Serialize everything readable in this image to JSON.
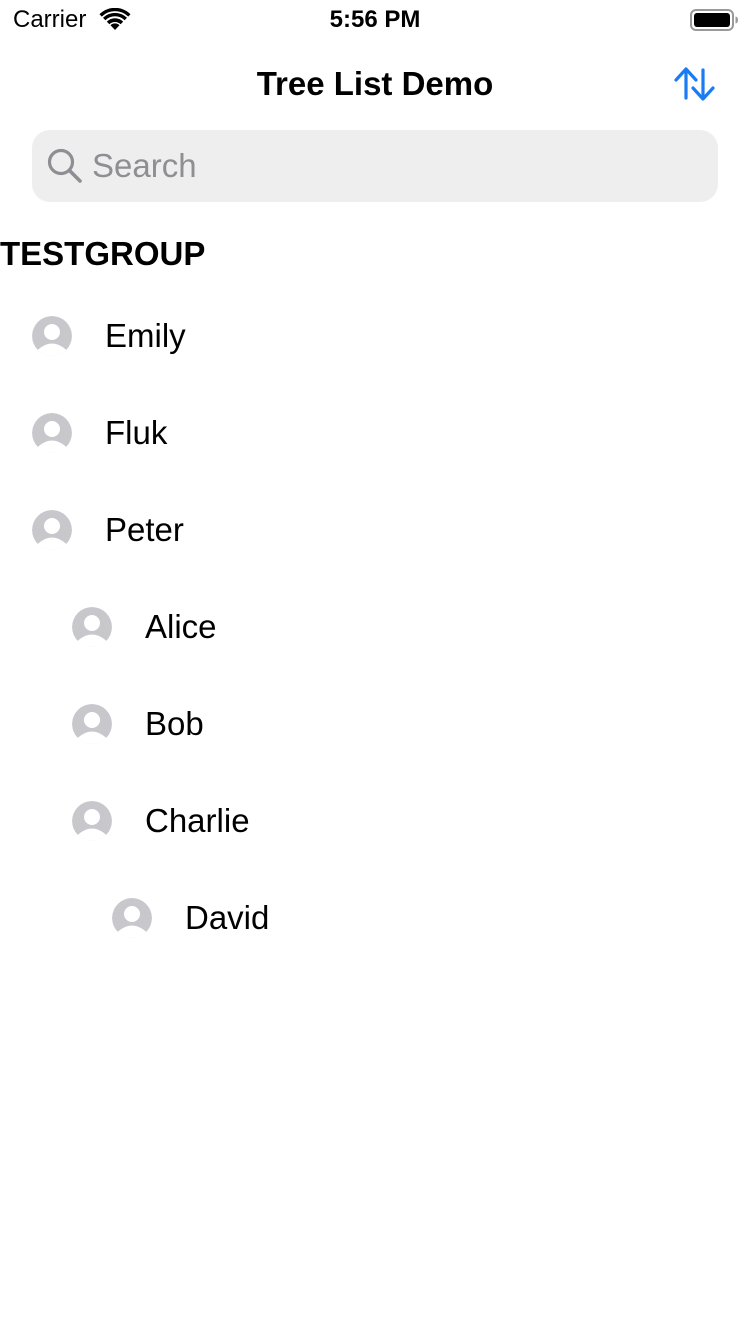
{
  "status_bar": {
    "carrier": "Carrier",
    "time": "5:56 PM"
  },
  "nav": {
    "title": "Tree List Demo",
    "sort_icon": "sort-arrows-icon"
  },
  "search": {
    "placeholder": "Search",
    "value": ""
  },
  "section": {
    "title": "TESTGROUP"
  },
  "tree": {
    "items": [
      {
        "label": "Emily",
        "depth": 0
      },
      {
        "label": "Fluk",
        "depth": 0
      },
      {
        "label": "Peter",
        "depth": 0
      },
      {
        "label": "Alice",
        "depth": 1
      },
      {
        "label": "Bob",
        "depth": 1
      },
      {
        "label": "Charlie",
        "depth": 1
      },
      {
        "label": "David",
        "depth": 2
      }
    ]
  },
  "colors": {
    "accent": "#1a7cf5",
    "avatar": "#c7c7cc",
    "search_bg": "#eeeeef",
    "placeholder": "#8e8e93"
  }
}
